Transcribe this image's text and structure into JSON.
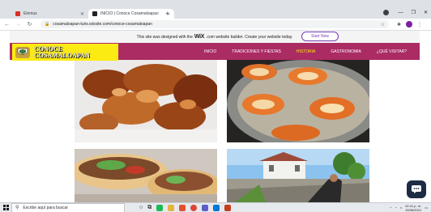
{
  "browser": {
    "tabs": [
      {
        "title": "Elnmus",
        "active": false,
        "favicon_color": "#d93025"
      },
      {
        "title": "INICIO | Conoce Cosamaloapan",
        "active": true,
        "favicon_color": "#202124"
      }
    ],
    "new_tab_icon": "plus-icon",
    "url": "cosamaloapan-turis.wixsite.com/conoce-cosamaloapan"
  },
  "wix_banner": {
    "text_before": "This site was designed with the",
    "logo": "WiX",
    "text_after": ".com website builder. Create your website today.",
    "button": "Start Now"
  },
  "site": {
    "logo_line1": "CONOCE",
    "logo_line2": "COSAMALOAPAN",
    "nav": [
      "INICIO",
      "TRADICIONES Y FIESTAS",
      "HISTORIA",
      "GASTRONOMIA",
      "¿QUÉ VISITAR?"
    ],
    "current_nav": "HISTORIA",
    "colors": {
      "header": "#ab2b63",
      "logo_bg": "#fbeb12",
      "nav_active": "#fbeb12"
    }
  },
  "photos": [
    {
      "subject": "fried-food-photo"
    },
    {
      "subject": "frying-pan-photo"
    },
    {
      "subject": "tacos-photo"
    },
    {
      "subject": "town-landscape-photo"
    }
  ],
  "chat_icon": "chat-bubble-icon",
  "taskbar": {
    "search_placeholder": "Escribe aquí para buscar",
    "time": "02:41 p. m.",
    "date": "15/06/2021"
  }
}
